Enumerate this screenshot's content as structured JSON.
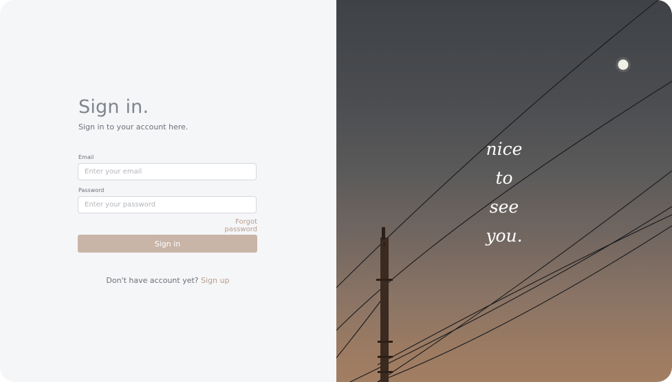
{
  "signin": {
    "title": "Sign in.",
    "subtitle": "Sign in to your account here.",
    "email_label": "Email",
    "email_placeholder": "Enter your email",
    "password_label": "Password",
    "password_placeholder": "Enter your password",
    "forgot_link": "Forgot password",
    "submit_label": "Sign in",
    "signup_prompt": "Don't have account yet?",
    "signup_link": "Sign up"
  },
  "hero": {
    "tagline_lines": [
      "nice",
      "to",
      "see",
      "you."
    ]
  },
  "colors": {
    "accent": "#b79d8c",
    "button": "#c8b5a8",
    "panel_bg": "#f5f6f8"
  }
}
